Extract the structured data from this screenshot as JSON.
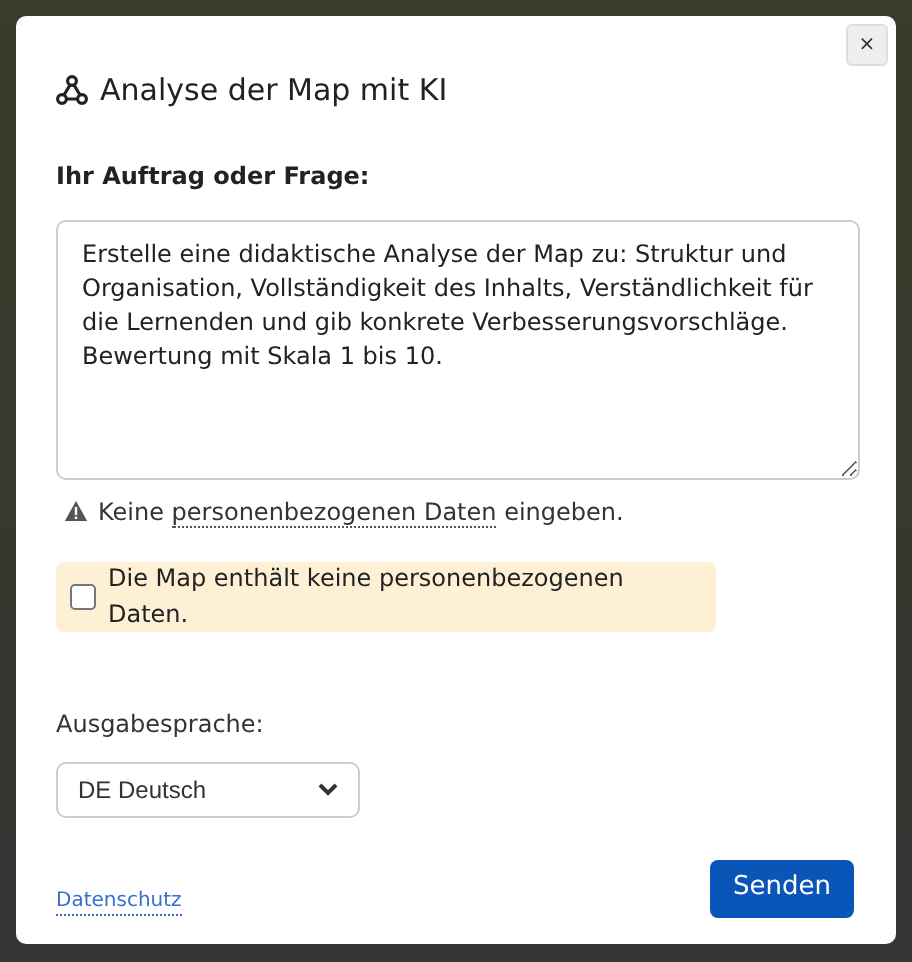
{
  "dialog": {
    "title": "Analyse der Map mit KI",
    "close": "×"
  },
  "prompt": {
    "label": "Ihr Auftrag oder Frage:",
    "value": "Erstelle eine didaktische Analyse der Map zu: Struktur und Organisation, Vollständigkeit des Inhalts, Verständlichkeit für die Lernenden und gib konkrete Verbesserungsvorschläge. Bewertung mit Skala 1 bis 10."
  },
  "warning": {
    "before": "Keine ",
    "link": "personenbezogenen Daten",
    "after": " eingeben."
  },
  "consent": {
    "label": "Die Map enthält keine personenbezogenen Daten.",
    "checked": false
  },
  "language": {
    "label": "Ausgabesprache:",
    "value": "DE Deutsch"
  },
  "footer": {
    "link": "Datenschutz",
    "button": "Senden"
  }
}
